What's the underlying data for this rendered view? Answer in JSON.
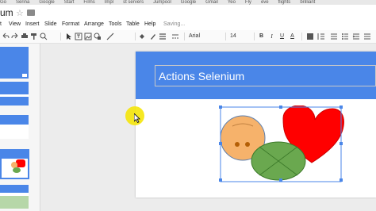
{
  "bookmarks": [
    "Go",
    "Serina",
    "Google",
    "Start",
    "Films",
    "Impl",
    "st servers",
    "Jumpool",
    "Google",
    "Gmail",
    "Yeo",
    "Fly",
    "eve",
    "flights",
    "brilliant"
  ],
  "doc": {
    "title": "um",
    "star": "☆"
  },
  "menu": {
    "items": [
      "t",
      "View",
      "Insert",
      "Slide",
      "Format",
      "Arrange",
      "Tools",
      "Table",
      "Help"
    ],
    "status": "Saving..."
  },
  "toolbar": {
    "font": "Arial",
    "font_size": "14",
    "bold": "B",
    "italic": "I",
    "underline": "U",
    "text_color": "A"
  },
  "slide": {
    "title": "Actions Selenium"
  },
  "colors": {
    "accent": "#4a86e8",
    "heart": "#ff0000",
    "face": "#f6b26b",
    "ball": "#6aa84f",
    "selection": "#4a86e8"
  },
  "icons": [
    "star-icon",
    "folder-icon",
    "undo-icon",
    "redo-icon",
    "print-icon",
    "paint-format-icon",
    "zoom-icon",
    "select-icon",
    "textbox-icon",
    "image-icon",
    "shape-icon",
    "line-icon",
    "fill-color-icon",
    "border-color-icon",
    "border-weight-icon",
    "border-dash-icon",
    "bold-icon",
    "italic-icon",
    "underline-icon",
    "text-color-icon",
    "align-icon",
    "line-spacing-icon",
    "list-icon",
    "bullet-icon",
    "more-icon"
  ]
}
